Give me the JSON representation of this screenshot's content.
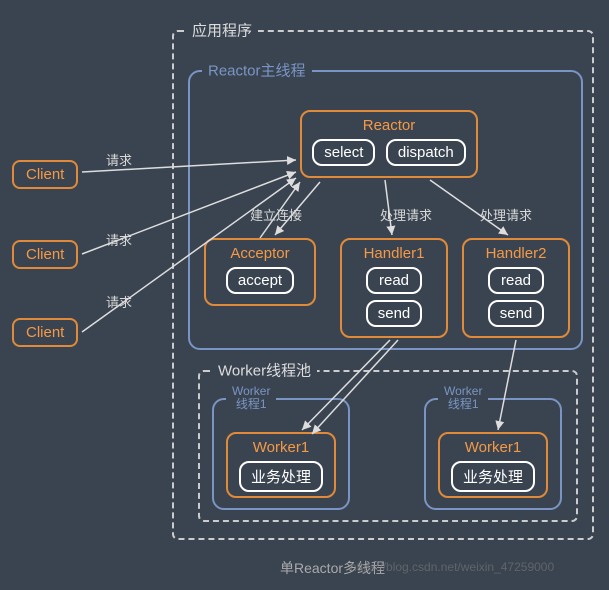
{
  "app": {
    "title": "应用程序"
  },
  "reactor_thread": {
    "title": "Reactor主线程"
  },
  "reactor": {
    "title": "Reactor",
    "select": "select",
    "dispatch": "dispatch"
  },
  "acceptor": {
    "title": "Acceptor",
    "accept": "accept"
  },
  "handler1": {
    "title": "Handler1",
    "read": "read",
    "send": "send"
  },
  "handler2": {
    "title": "Handler2",
    "read": "read",
    "send": "send"
  },
  "worker_pool": {
    "title": "Worker线程池"
  },
  "worker_thread1": {
    "title": "Worker\n线程1"
  },
  "worker_thread2": {
    "title": "Worker\n线程1"
  },
  "worker_box1": {
    "title": "Worker1",
    "task": "业务处理"
  },
  "worker_box2": {
    "title": "Worker1",
    "task": "业务处理"
  },
  "clients": {
    "c1": "Client",
    "c2": "Client",
    "c3": "Client"
  },
  "labels": {
    "req1": "请求",
    "req2": "请求",
    "req3": "请求",
    "establish": "建立连接",
    "handle1": "处理请求",
    "handle2": "处理请求"
  },
  "footer": {
    "caption": "单Reactor多线程"
  },
  "watermark": {
    "text": "https://blog.csdn.net/weixin_47259000"
  }
}
